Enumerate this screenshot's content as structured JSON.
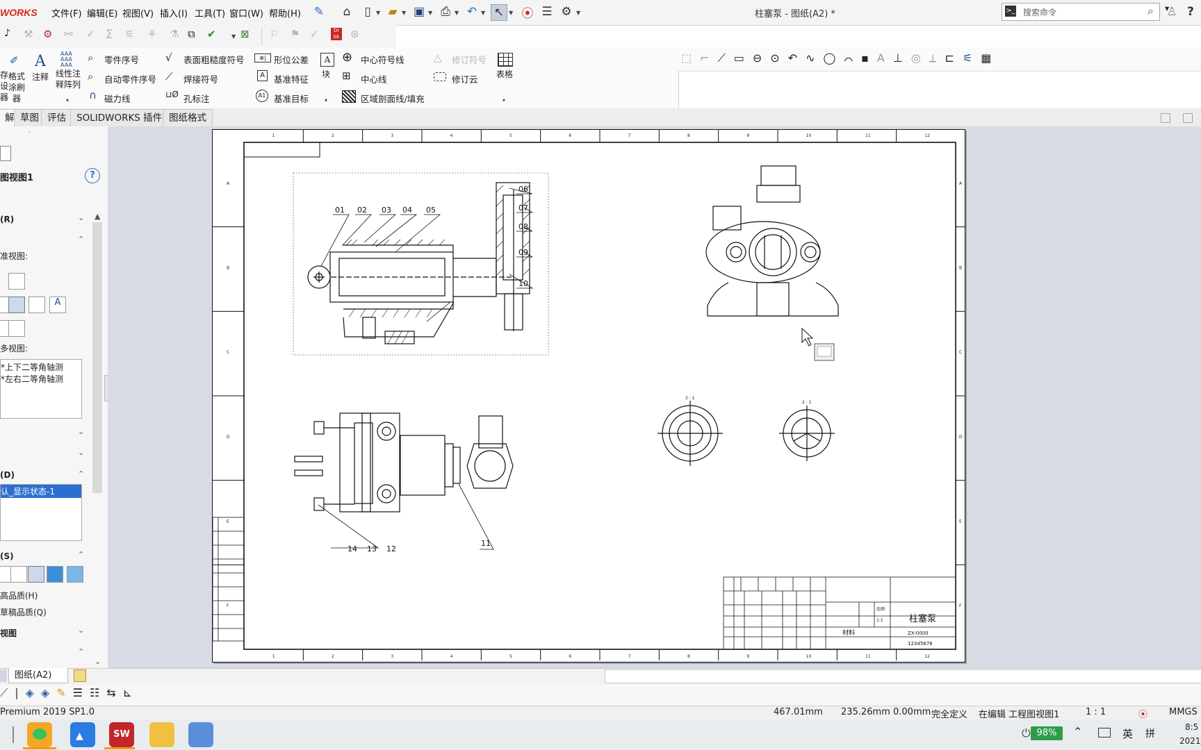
{
  "app": {
    "logo_text": "WORKS",
    "document_title": "柱塞泵 - 图纸(A2) *",
    "search_placeholder": "搜索命令"
  },
  "menus": [
    "文件(F)",
    "编辑(E)",
    "视图(V)",
    "插入(I)",
    "工具(T)",
    "窗口(W)",
    "帮助(H)"
  ],
  "command_manager": {
    "col1": [
      "格式",
      "涂刷",
      "器"
    ],
    "col1_left": [
      "存",
      "设",
      "器"
    ],
    "annotation": "注释",
    "linear_pattern": [
      "线性注",
      "释阵列"
    ],
    "balloon": "零件序号",
    "auto_balloon": "自动零件序号",
    "magnetic_line": "磁力线",
    "surface_finish": "表面粗糙度符号",
    "weld_symbol": "焊接符号",
    "hole_callout": "孔标注",
    "geo_tolerance": "形位公差",
    "datum_feature": "基准特征",
    "datum_target": "基准目标",
    "block": "块",
    "center_mark": "中心符号线",
    "centerline": "中心线",
    "area_hatch": "区域剖面线/填充",
    "revision_symbol": "修订符号",
    "revision_cloud": "修订云",
    "table": "表格"
  },
  "tabs": [
    "解",
    "草图",
    "评估",
    "SOLIDWORKS 插件",
    "图纸格式"
  ],
  "property_manager": {
    "title": "图视图1",
    "section_r": "(R)",
    "standard_views_label": "准视图:",
    "more_views_label": "多视图:",
    "more_views": [
      "*上下二等角轴测",
      "*左右二等角轴测"
    ],
    "section_d": "(D)",
    "display_state": "认_显示状态-1",
    "section_s": "(S)",
    "high_quality": "高品质(H)",
    "draft_quality": "草稿品质(Q)",
    "views_label": "视图"
  },
  "drawing": {
    "col_numbers": [
      "1",
      "2",
      "3",
      "4",
      "5",
      "6",
      "7",
      "8",
      "9",
      "10",
      "11",
      "12"
    ],
    "row_letters": [
      "A",
      "B",
      "C",
      "D",
      "E",
      "F"
    ],
    "balloons_top": [
      "01",
      "02",
      "03",
      "04",
      "05"
    ],
    "balloons_right": [
      "06",
      "07",
      "08",
      "09",
      "10"
    ],
    "balloon_11": "11",
    "balloons_bottom": [
      "14",
      "13",
      "12"
    ],
    "title_block": {
      "part_name": "柱塞泵",
      "drawing_no": "ZX-0000",
      "material_label": "材料",
      "company_no": "12345678",
      "scale_label": "比例",
      "scale_value": "1:1"
    }
  },
  "sheet_tab": "图纸(A2)",
  "status": {
    "version": "Premium 2019 SP1.0",
    "x": "467.01mm",
    "y": "235.26mm",
    "z": "0.00mm",
    "defined": "完全定义",
    "editing": "在编辑 工程图视图1",
    "scale": "1 : 1",
    "units": "MMGS"
  },
  "taskbar": {
    "battery": "98%",
    "ime": "英",
    "ime2": "拼",
    "time": "8:5",
    "date": "2021/"
  }
}
